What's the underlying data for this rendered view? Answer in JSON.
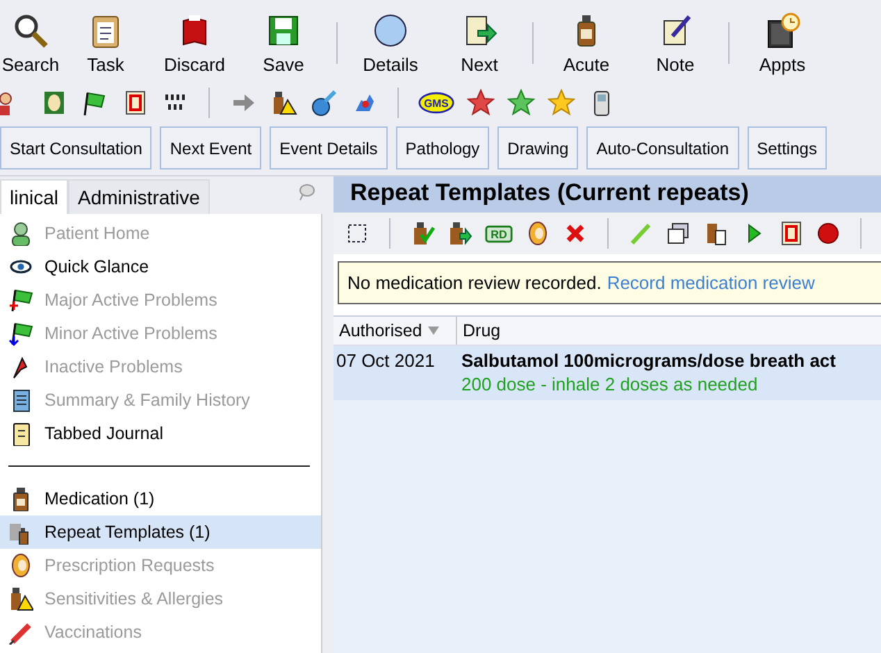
{
  "main_toolbar": [
    {
      "label": "Search"
    },
    {
      "label": "Task"
    },
    {
      "label": "Discard"
    },
    {
      "label": "Save"
    },
    {
      "label": "Details"
    },
    {
      "label": "Next"
    },
    {
      "label": "Acute"
    },
    {
      "label": "Note"
    },
    {
      "label": "Appts"
    }
  ],
  "icon_toolbar": {
    "gms_label": "GMS"
  },
  "action_buttons": [
    "Start Consultation",
    "Next Event",
    "Event Details",
    "Pathology",
    "Drawing",
    "Auto-Consultation",
    "Settings"
  ],
  "tabs": [
    {
      "label": "linical",
      "selected": true
    },
    {
      "label": "Administrative",
      "selected": false
    }
  ],
  "sidebar": {
    "groups": [
      [
        {
          "label": "Patient Home",
          "disabled": true,
          "selected": false
        },
        {
          "label": "Quick Glance",
          "disabled": false,
          "selected": false
        },
        {
          "label": "Major Active Problems",
          "disabled": true,
          "selected": false
        },
        {
          "label": "Minor Active Problems",
          "disabled": true,
          "selected": false
        },
        {
          "label": "Inactive Problems",
          "disabled": true,
          "selected": false
        },
        {
          "label": "Summary & Family History",
          "disabled": true,
          "selected": false
        },
        {
          "label": "Tabbed Journal",
          "disabled": false,
          "selected": false
        }
      ],
      [
        {
          "label": "Medication (1)",
          "disabled": false,
          "selected": false
        },
        {
          "label": "Repeat Templates (1)",
          "disabled": false,
          "selected": true
        },
        {
          "label": "Prescription Requests",
          "disabled": true,
          "selected": false
        },
        {
          "label": "Sensitivities & Allergies",
          "disabled": true,
          "selected": false
        },
        {
          "label": "Vaccinations",
          "disabled": true,
          "selected": false
        }
      ]
    ]
  },
  "panel": {
    "title": "Repeat Templates (Current repeats)",
    "toolbar": {
      "badge": "RD"
    },
    "notice": {
      "text": "No medication review recorded.",
      "link": "Record medication review"
    },
    "table": {
      "columns": [
        {
          "label": "Authorised",
          "sorted": true
        },
        {
          "label": "Drug",
          "sorted": false
        }
      ],
      "rows": [
        {
          "authorised": "07 Oct 2021",
          "drug": "Salbutamol 100micrograms/dose breath act",
          "detail": "200 dose - inhale 2 doses as needed",
          "selected": true
        }
      ]
    }
  }
}
